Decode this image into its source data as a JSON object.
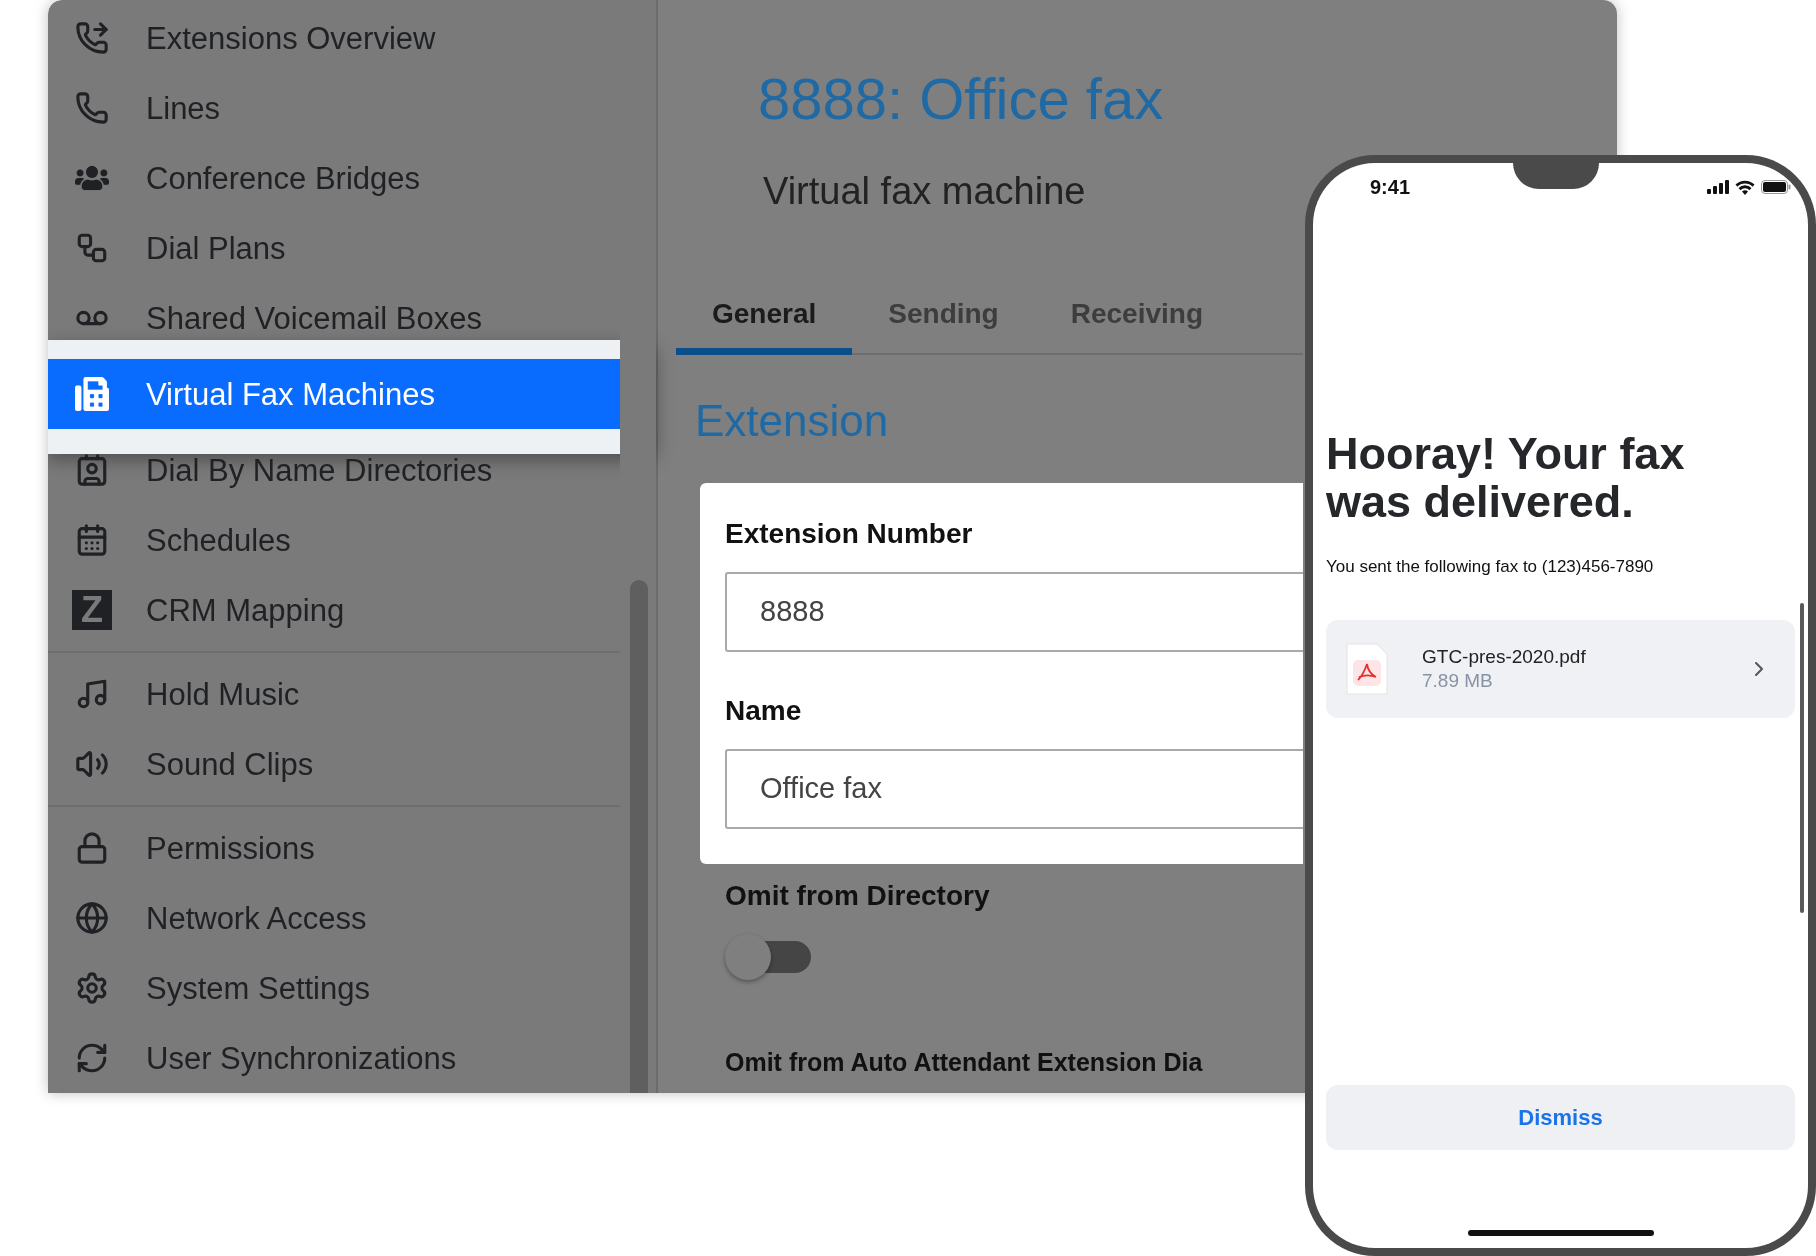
{
  "sidebar": {
    "sections": [
      [
        {
          "label": "Extensions Overview",
          "selected": false
        },
        {
          "label": "Lines",
          "selected": false
        },
        {
          "label": "Conference Bridges",
          "selected": false
        },
        {
          "label": "Dial Plans",
          "selected": false
        },
        {
          "label": "Shared Voicemail Boxes",
          "selected": false
        },
        {
          "label": "Virtual Fax Machines",
          "selected": true
        },
        {
          "label": "Dial By Name Directories",
          "selected": false
        },
        {
          "label": "Schedules",
          "selected": false
        },
        {
          "label": "CRM Mapping",
          "selected": false,
          "logo_letter": "Z"
        }
      ],
      [
        {
          "label": "Hold Music",
          "selected": false
        },
        {
          "label": "Sound Clips",
          "selected": false
        }
      ],
      [
        {
          "label": "Permissions",
          "selected": false
        },
        {
          "label": "Network Access",
          "selected": false
        },
        {
          "label": "System Settings",
          "selected": false
        },
        {
          "label": "User Synchronizations",
          "selected": false
        }
      ]
    ]
  },
  "main": {
    "title": "8888: Office fax",
    "subtitle": "Virtual fax machine",
    "tabs": [
      {
        "label": "General",
        "selected": true
      },
      {
        "label": "Sending",
        "selected": false
      },
      {
        "label": "Receiving",
        "selected": false
      }
    ],
    "section_heading": "Extension",
    "fields": [
      {
        "label": "Extension Number",
        "value": "8888"
      },
      {
        "label": "Name",
        "value": "Office fax"
      }
    ],
    "toggles": [
      {
        "label": "Omit from Directory",
        "on": false
      }
    ],
    "cut_label": "Omit from Auto Attendant Extension Dia"
  },
  "phone": {
    "time": "9:41",
    "heading": "Hooray! Your fax was delivered.",
    "message": "You sent the following fax to (123)456-7890",
    "file": {
      "name": "GTC-pres-2020.pdf",
      "size": "7.89 MB"
    },
    "button": "Dismiss"
  }
}
